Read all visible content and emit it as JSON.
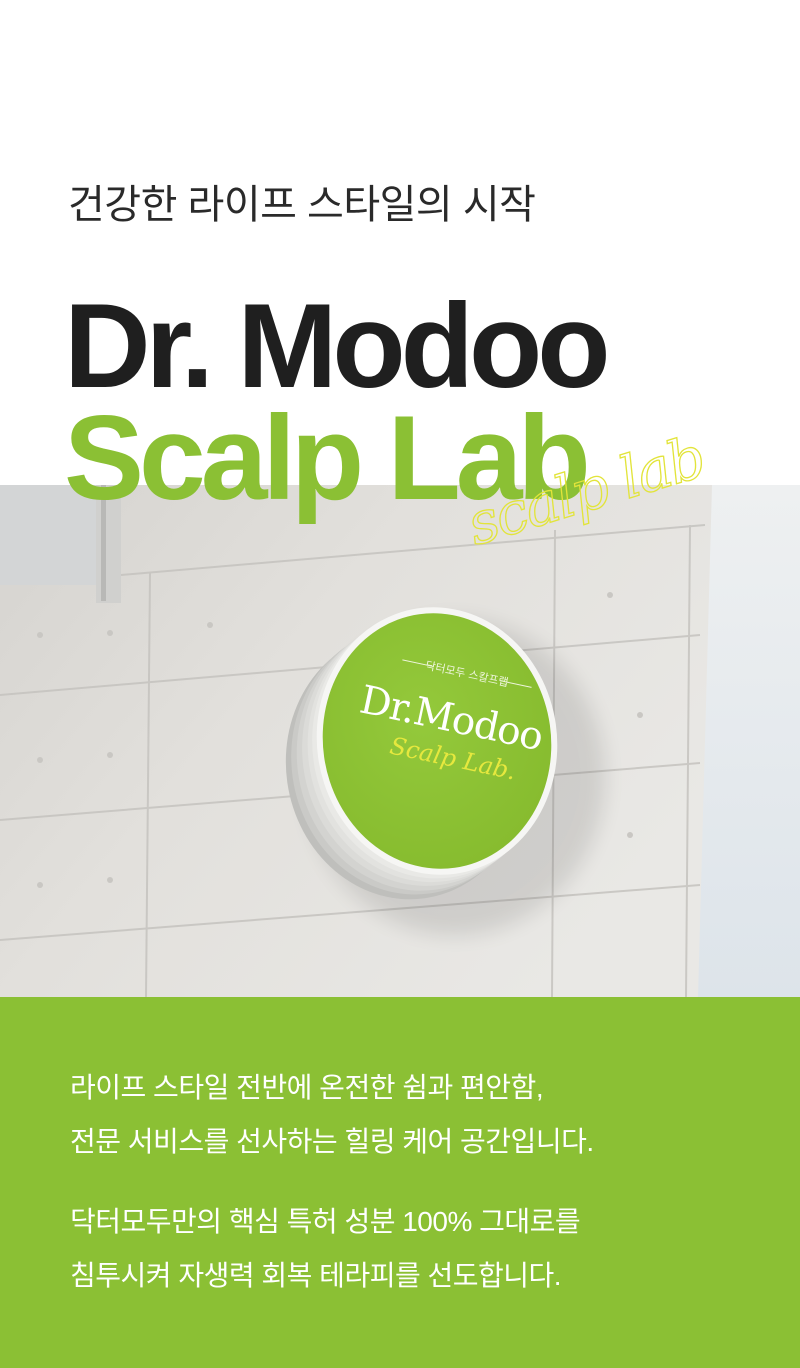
{
  "hero": {
    "subtitle": "건강한 라이프 스타일의 시작",
    "title_line1": "Dr. Modoo",
    "title_line2": "Scalp Lab",
    "script_overlay": "scalp lab"
  },
  "photo": {
    "sign": {
      "korean_label": "닥터모두 스칼프랩",
      "brand": "Dr.Modoo",
      "script": "Scalp Lab."
    }
  },
  "description": {
    "paragraphs": [
      {
        "lines": [
          "라이프 스타일 전반에 온전한 쉼과 편안함,",
          "전문 서비스를 선사하는 힐링 케어 공간입니다."
        ]
      },
      {
        "lines": [
          "닥터모두만의 핵심 특허 성분 100% 그대로를",
          "침투시켜 자생력 회복 테라피를 선도합니다."
        ]
      }
    ]
  },
  "colors": {
    "brand_green": "#8bc034",
    "accent_yellow": "#e2e43a",
    "text_dark": "#1f1f1f",
    "description_text": "#ffffff"
  }
}
